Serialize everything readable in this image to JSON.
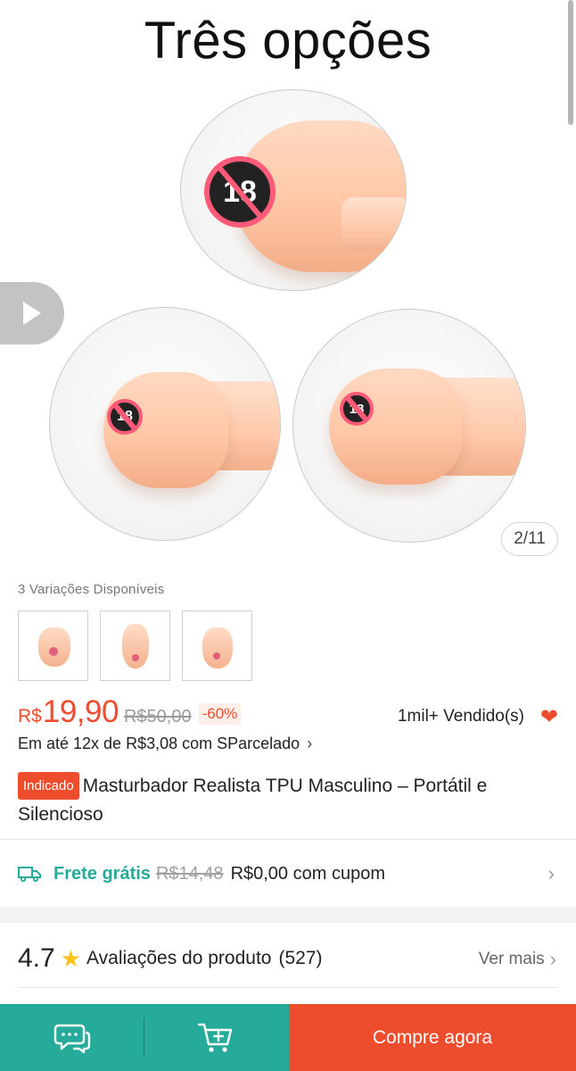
{
  "gallery": {
    "title": "Três opções",
    "counter": "2/11",
    "badge_text": "18"
  },
  "variations": {
    "label": "3 Variações Disponíveis",
    "count": 3
  },
  "price": {
    "currency": "R$",
    "value": "19,90",
    "old": "R$50,00",
    "discount": "-60%",
    "sold": "1mil+ Vendido(s)",
    "installment": "Em até 12x de R$3,08 com SParcelado"
  },
  "product": {
    "tag": "Indicado",
    "title": "Masturbador Realista TPU Masculino – Portátil e Silencioso"
  },
  "shipping": {
    "free_label": "Frete grátis",
    "old": "R$14,48",
    "new": "R$0,00 com cupom"
  },
  "reviews": {
    "rating": "4.7",
    "label": "Avaliações do produto",
    "count": "(527)",
    "see_more": "Ver mais"
  },
  "bottom_bar": {
    "buy_label": "Compre agora"
  },
  "colors": {
    "accent": "#ee4d2d",
    "teal": "#26aa99",
    "star": "#ffc21a"
  },
  "icons": [
    "play-icon",
    "heart-icon",
    "chevron-right-icon",
    "truck-icon",
    "star-icon",
    "chat-icon",
    "add-to-cart-icon",
    "age-18-badge-icon"
  ]
}
